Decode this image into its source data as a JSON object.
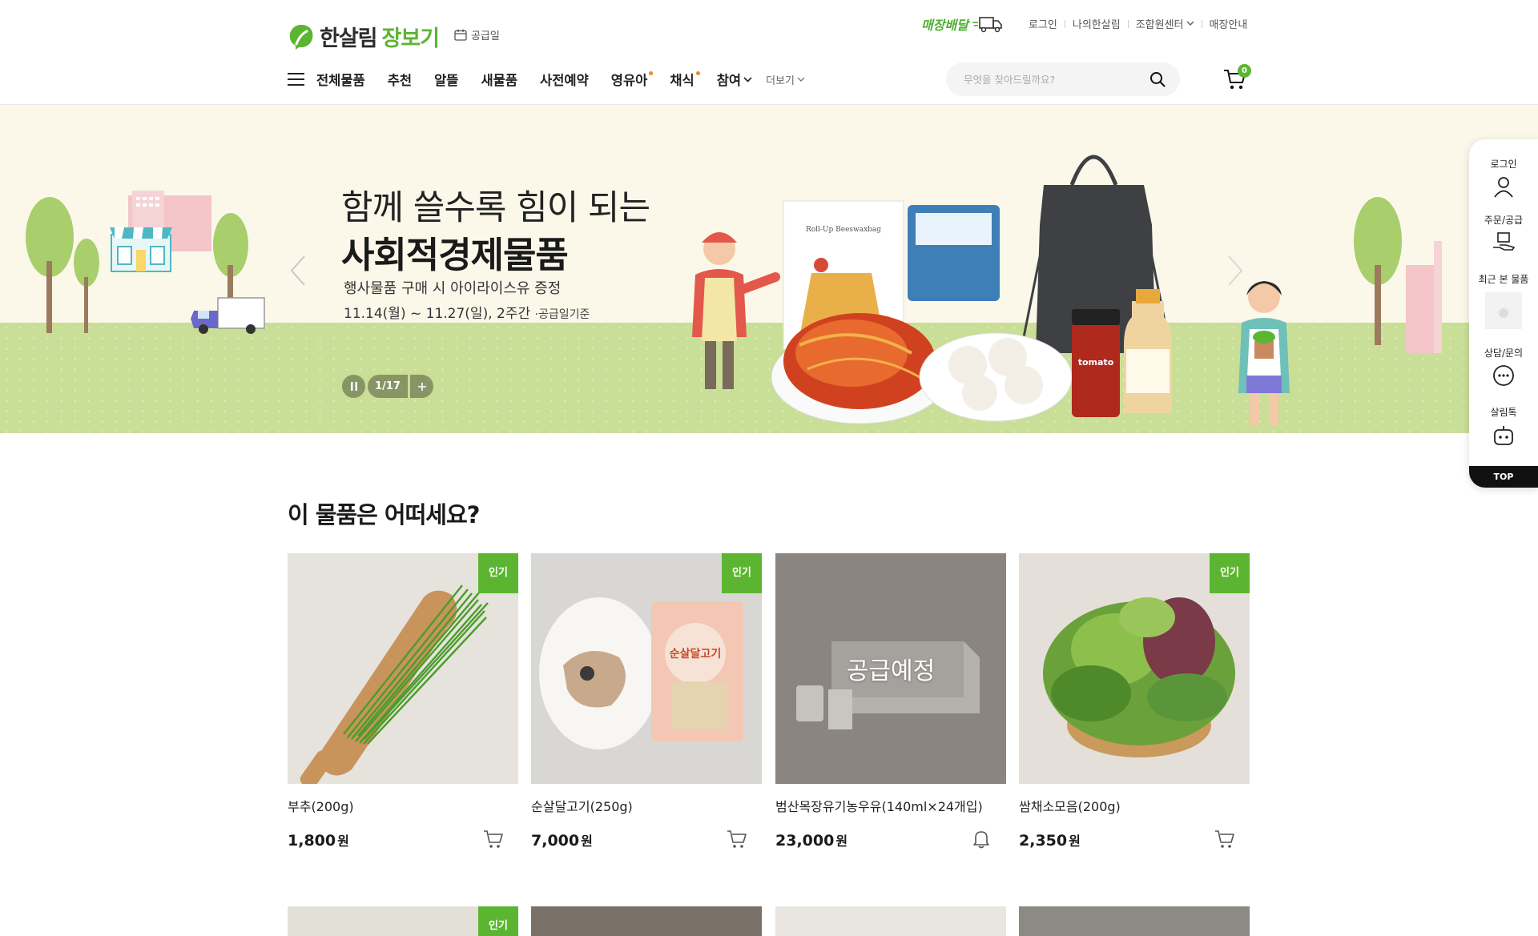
{
  "header": {
    "logo_main": "한살림",
    "logo_sub": "장보기",
    "supply_day": "공급일",
    "store_delivery": "매장배달",
    "util": [
      "로그인",
      "나의한살림",
      "조합원센터",
      "매장안내"
    ],
    "cart_count": "0",
    "search_placeholder": "무엇을 찾아드릴까요?"
  },
  "gnb": {
    "items": [
      "전체물품",
      "추천",
      "알뜰",
      "새물품",
      "사전예약",
      "영유아",
      "채식",
      "참여"
    ],
    "more": "더보기"
  },
  "banner": {
    "title1": "함께 쓸수록 힘이 되는",
    "title2": "사회적경제물품",
    "desc1": "행사물품 구매 시 아이라이스유 증정",
    "desc2": "11.14(월) ~ 11.27(일), 2주간",
    "desc2_note": "·공급일기준",
    "page": "1/17",
    "product_labels": [
      "Roll-Up Beeswaxbag",
      "tomato",
      "아이라이스유"
    ]
  },
  "quickbar": {
    "items": [
      "로그인",
      "주문/공급",
      "최근 본 물품",
      "상담/문의",
      "살림톡"
    ],
    "top": "TOP"
  },
  "section": {
    "title": "이 물품은 어떠세요?",
    "badge_label": "인기",
    "price_unit": "원",
    "coming_label": "공급예정",
    "products": [
      {
        "name": "부추(200g)",
        "price": "1,800",
        "badge": "인기"
      },
      {
        "name": "순살달고기(250g)",
        "price": "7,000",
        "badge": "인기",
        "pack_label": "순살달고기"
      },
      {
        "name": "범산목장유기농우유(140ml×24개입)",
        "price": "23,000",
        "status": "공급예정"
      },
      {
        "name": "쌈채소모음(200g)",
        "price": "2,350",
        "badge": "인기"
      }
    ]
  },
  "colors": {
    "accent": "#5cb531",
    "banner_bg": "#fbf8ea",
    "grass": "#c9de96"
  }
}
